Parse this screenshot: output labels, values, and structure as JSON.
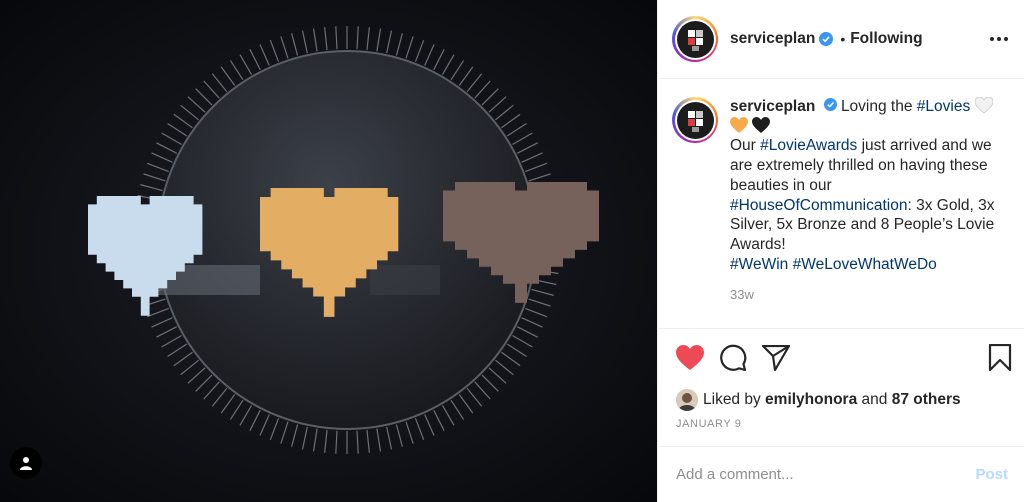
{
  "post": {
    "photo_icon": "person-tag-icon",
    "header": {
      "username": "serviceplan",
      "separator": "•",
      "follow_status": "Following",
      "more_icon": "more-options-icon"
    },
    "caption": {
      "username": "serviceplan",
      "text_1": "Loving the",
      "tag_1": "#Lovies",
      "text_2": "Our",
      "tag_2": "#LovieAwards",
      "text_3": "just arrived and we are extremely thrilled on having these beauties in our",
      "tag_3": "#HouseOfCommunication",
      "text_4": ": 3x Gold, 3x Silver, 5x Bronze and 8 People’s Lovie Awards!",
      "tag_4": "#WeWin",
      "tag_5": "#WeLoveWhatWeDo",
      "emojis": [
        "white-heart",
        "orange-heart",
        "black-heart"
      ],
      "time": "33w"
    },
    "actions": {
      "like_icon": "heart-filled-icon",
      "comment_icon": "comment-icon",
      "share_icon": "paper-plane-icon",
      "save_icon": "bookmark-icon"
    },
    "likes": {
      "prefix": "Liked by",
      "user": "emilyhonora",
      "conjunction": "and",
      "others": "87 others"
    },
    "date": "JANUARY 9",
    "add_comment": {
      "placeholder": "Add a comment...",
      "post_label": "Post"
    },
    "colors": {
      "like_red": "#ed4956",
      "verified_blue": "#3897f0",
      "link_blue": "#00376b",
      "post_disabled": "#b3dbff",
      "heart_light_blue": "#c9dcee",
      "heart_gold": "#e3ad63",
      "heart_bronze": "#76625a"
    }
  }
}
